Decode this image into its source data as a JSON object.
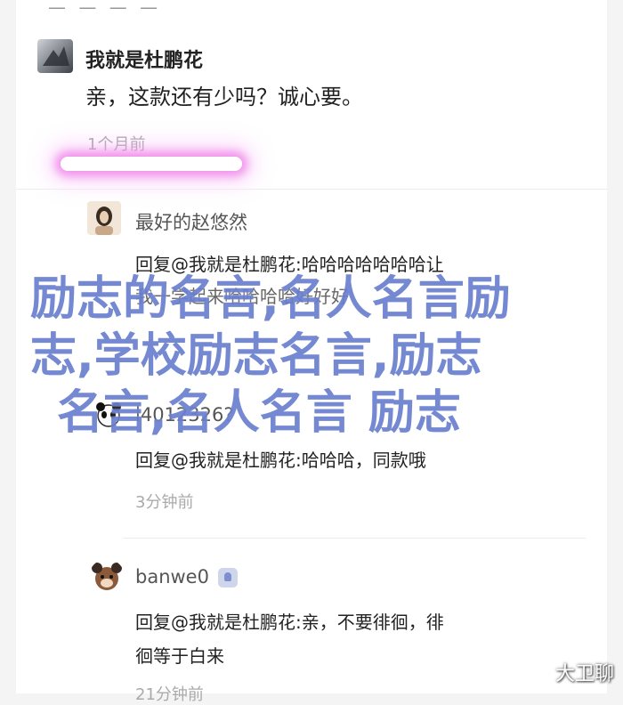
{
  "comment": {
    "author": "我就是杜鹏花",
    "text": "亲，这款还有少吗？诚心要。",
    "time": "1个月前"
  },
  "replies": [
    {
      "author": "最好的赵悠然",
      "line1": "回复@我就是杜鹏花:哈哈哈哈哈哈哈让",
      "line2": "我一学起来哈哈哈哈好好好"
    },
    {
      "author": "l4012326?",
      "text": "回复@我就是杜鹏花:哈哈哈，同款哦",
      "time": "3分钟前"
    },
    {
      "author": "banwe0",
      "line1": "回复@我就是杜鹏花:亲，不要徘徊，徘",
      "line2": "徊等于白来",
      "time": "21分钟前"
    }
  ],
  "overlay": {
    "line1": "励志的名言,名人名言励",
    "line2": "志,学校励志名言,励志",
    "line3": "名言,名人名言 励志"
  },
  "watermark": "大卫聊",
  "colors": {
    "overlay_text": "#6a7fd0",
    "highlight_glow": "#ee78e6",
    "timestamp": "#aaaaaa"
  }
}
